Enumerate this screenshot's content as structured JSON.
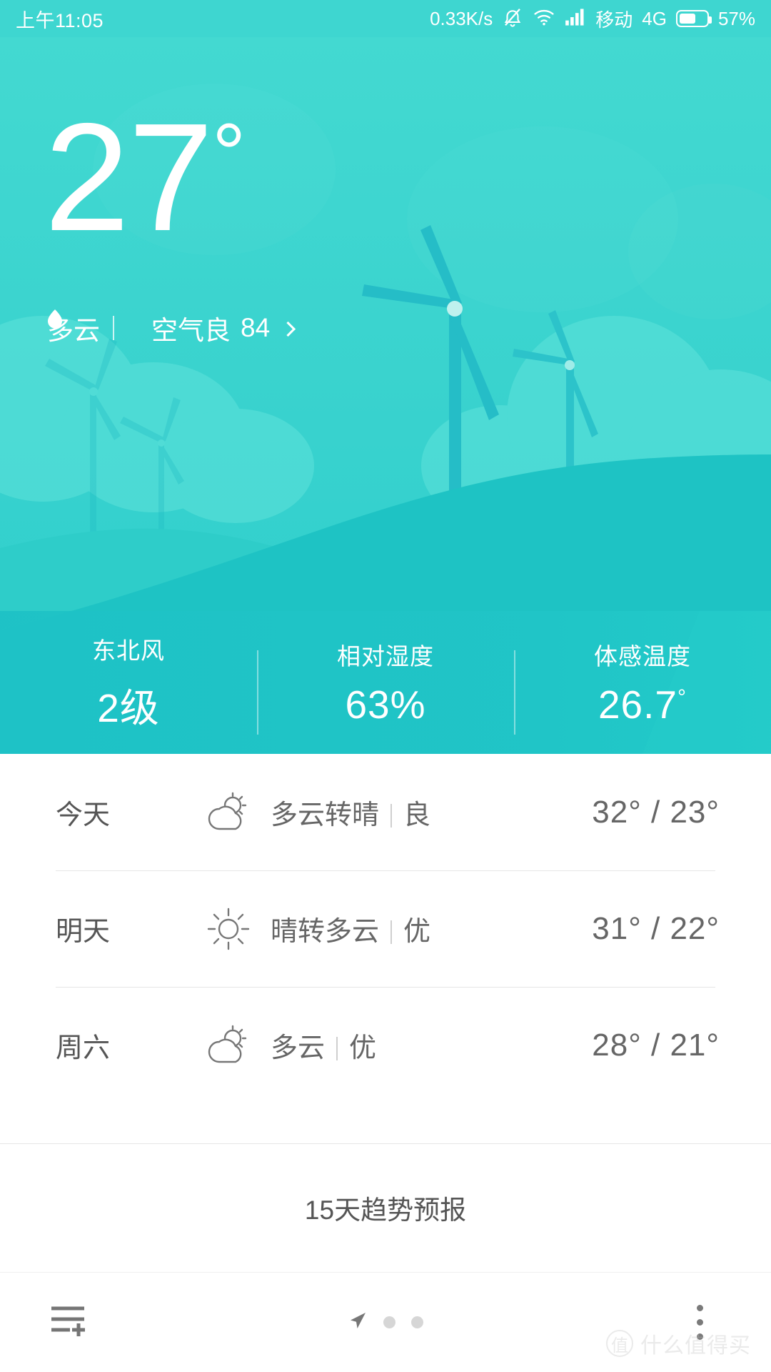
{
  "statusbar": {
    "time": "上午11:05",
    "network_speed": "0.33K/s",
    "mute_icon": "bell-muted-icon",
    "wifi_icon": "wifi-icon",
    "signal_icon": "signal-bars-icon",
    "carrier": "移动",
    "network_type": "4G",
    "battery_icon": "battery-icon",
    "battery_percent": "57%"
  },
  "hero": {
    "temperature": "27",
    "degree": "°",
    "condition": "多云",
    "separator": "|",
    "aqi_icon": "leaf-icon",
    "aqi_label": "空气良",
    "aqi_value": "84",
    "chevron": "chevron-right-icon",
    "background_illustration": "wind-turbines-hills-illustration",
    "colors": {
      "sky_top": "#41d8d0",
      "sky_bottom": "#2ecfcd",
      "hill_far": "#2ecdc9",
      "hill_near": "#1ec3c4",
      "turbine": "#24bcc6",
      "cloud": "#5ce0d8",
      "statusbar_bg": "#3ed6d0"
    }
  },
  "metrics": [
    {
      "label": "东北风",
      "value": "2级",
      "sup": ""
    },
    {
      "label": "相对湿度",
      "value": "63%",
      "sup": ""
    },
    {
      "label": "体感温度",
      "value": "26.7",
      "sup": "°"
    }
  ],
  "forecast": [
    {
      "day": "今天",
      "icon": "partly-cloudy-icon",
      "description": "多云转晴",
      "divider": "|",
      "aqi": "良",
      "high": "32",
      "low": "23",
      "temp_range": "32° / 23°"
    },
    {
      "day": "明天",
      "icon": "sun-icon",
      "description": "晴转多云",
      "divider": "|",
      "aqi": "优",
      "high": "31",
      "low": "22",
      "temp_range": "31° / 22°"
    },
    {
      "day": "周六",
      "icon": "partly-cloudy-icon",
      "description": "多云",
      "divider": "|",
      "aqi": "优",
      "high": "28",
      "low": "21",
      "temp_range": "28° / 21°"
    }
  ],
  "trend": {
    "label": "15天趋势预报"
  },
  "bottombar": {
    "add_city_icon": "add-city-list-icon",
    "location_icon": "location-arrow-icon",
    "page_dots": 2,
    "menu_icon": "overflow-menu-icon"
  },
  "watermark": {
    "mark": "值",
    "text": "什么值得买"
  }
}
